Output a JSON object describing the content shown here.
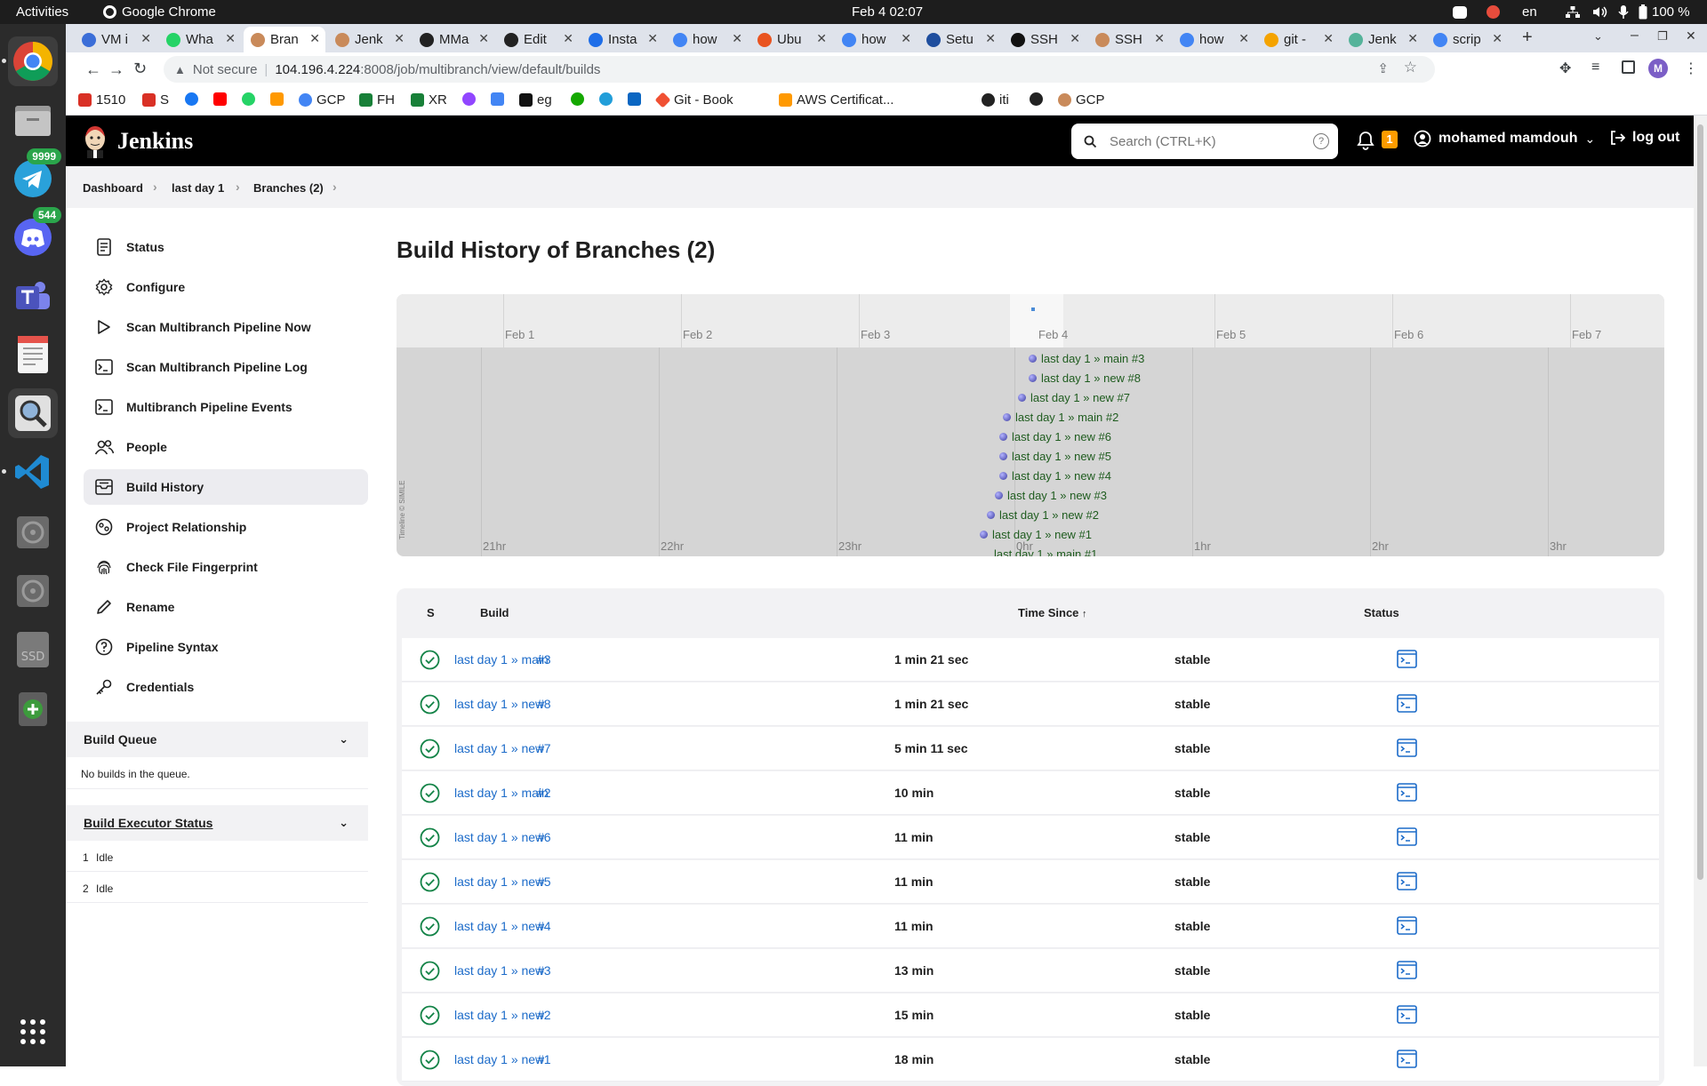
{
  "system_bar": {
    "activities": "Activities",
    "app": "Google Chrome",
    "clock": "Feb 4  02:07",
    "lang": "en",
    "battery": "100 %"
  },
  "dock": {
    "badges": [
      "9999",
      "544"
    ]
  },
  "browser": {
    "tabs": [
      {
        "label": "VM i",
        "color": "#3b6ed8"
      },
      {
        "label": "Wha",
        "color": "#25d366"
      },
      {
        "label": "Bran",
        "color": "#c98a5a"
      },
      {
        "label": "Jenk",
        "color": "#c98a5a"
      },
      {
        "label": "MMa",
        "color": "#222222"
      },
      {
        "label": "Edit",
        "color": "#222222"
      },
      {
        "label": "Insta",
        "color": "#1e6ee8"
      },
      {
        "label": "how",
        "color": "#4285f4"
      },
      {
        "label": "Ubu",
        "color": "#e95420"
      },
      {
        "label": "how",
        "color": "#4285f4"
      },
      {
        "label": "Setu",
        "color": "#1f4e9e"
      },
      {
        "label": "SSH",
        "color": "#111111"
      },
      {
        "label": "SSH",
        "color": "#c98a5a"
      },
      {
        "label": "how",
        "color": "#4285f4"
      },
      {
        "label": "git -",
        "color": "#f4a300"
      },
      {
        "label": "Jenk",
        "color": "#55b39a"
      },
      {
        "label": "scrip",
        "color": "#4285f4"
      }
    ],
    "security": "Not secure",
    "url_host": "104.196.4.224",
    "url_rest": ":8008/job/multibranch/view/default/builds",
    "profile_initial": "M",
    "bookmarks": [
      {
        "label": "1510",
        "color": "#d93025"
      },
      {
        "label": "S",
        "color": "#d93025"
      },
      {
        "label": "",
        "color": "#1877f2"
      },
      {
        "label": "",
        "color": "#ff0000"
      },
      {
        "label": "",
        "color": "#25d366"
      },
      {
        "label": "",
        "color": "#ff9900"
      },
      {
        "label": "GCP",
        "color": "#4285f4"
      },
      {
        "label": "FH",
        "color": "#188038"
      },
      {
        "label": "XR",
        "color": "#188038"
      },
      {
        "label": "",
        "color": "#9146ff"
      },
      {
        "label": "",
        "color": "#4285f4"
      },
      {
        "label": "eg",
        "color": "#111111"
      },
      {
        "label": "",
        "color": "#14a800"
      },
      {
        "label": "",
        "color": "#229ed9"
      },
      {
        "label": "",
        "color": "#0a66c2"
      },
      {
        "label": "Git - Book",
        "color": "#f05033"
      },
      {
        "label": "AWS Certificat...",
        "color": "#ff9900"
      },
      {
        "label": "iti",
        "color": "#222222"
      },
      {
        "label": "",
        "color": "#222222"
      },
      {
        "label": "GCP",
        "color": "#c98a5a"
      }
    ]
  },
  "jenkins": {
    "brand": "Jenkins",
    "search_placeholder": "Search (CTRL+K)",
    "notifications": "1",
    "user": "mohamed mamdouh",
    "logout": "log out"
  },
  "breadcrumbs": [
    "Dashboard",
    "last day 1",
    "Branches (2)"
  ],
  "sidebar": {
    "items": [
      {
        "label": "Status",
        "icon": "document-icon"
      },
      {
        "label": "Configure",
        "icon": "gear-icon"
      },
      {
        "label": "Scan Multibranch Pipeline Now",
        "icon": "play-icon"
      },
      {
        "label": "Scan Multibranch Pipeline Log",
        "icon": "terminal-icon"
      },
      {
        "label": "Multibranch Pipeline Events",
        "icon": "terminal-icon"
      },
      {
        "label": "People",
        "icon": "people-icon"
      },
      {
        "label": "Build History",
        "icon": "inbox-icon",
        "selected": true
      },
      {
        "label": "Project Relationship",
        "icon": "relationship-icon"
      },
      {
        "label": "Check File Fingerprint",
        "icon": "fingerprint-icon"
      },
      {
        "label": "Rename",
        "icon": "pencil-icon"
      },
      {
        "label": "Pipeline Syntax",
        "icon": "help-icon"
      },
      {
        "label": "Credentials",
        "icon": "key-icon"
      }
    ],
    "build_queue": {
      "title": "Build Queue",
      "empty": "No builds in the queue."
    },
    "executors": {
      "title": "Build Executor Status",
      "rows": [
        {
          "num": "1",
          "state": "Idle"
        },
        {
          "num": "2",
          "state": "Idle"
        }
      ]
    }
  },
  "main": {
    "title": "Build History of Branches (2)",
    "timeline": {
      "days": [
        "Feb 1",
        "Feb 2",
        "Feb 3",
        "Feb 4",
        "Feb 5",
        "Feb 6",
        "Feb 7"
      ],
      "hours": [
        "21hr",
        "22hr",
        "23hr",
        "0hr",
        "1hr",
        "2hr",
        "3hr"
      ],
      "credit": "Timeline © SIMILE",
      "events": [
        "last day 1 » main #3",
        "last day 1 » new #8",
        "last day 1 » new #7",
        "last day 1 » main #2",
        "last day 1 » new #6",
        "last day 1 » new #5",
        "last day 1 » new #4",
        "last day 1 » new #3",
        "last day 1 » new #2",
        "last day 1 » new #1",
        "last day 1 » main #1"
      ]
    },
    "table": {
      "headers": {
        "s": "S",
        "build": "Build",
        "time": "Time Since",
        "sort": "↑",
        "status": "Status"
      },
      "rows": [
        {
          "branch": "last day 1 » main",
          "num": "#3",
          "time": "1 min 21 sec",
          "status": "stable"
        },
        {
          "branch": "last day 1 » new",
          "num": "#8",
          "time": "1 min 21 sec",
          "status": "stable"
        },
        {
          "branch": "last day 1 » new",
          "num": "#7",
          "time": "5 min 11 sec",
          "status": "stable"
        },
        {
          "branch": "last day 1 » main",
          "num": "#2",
          "time": "10 min",
          "status": "stable"
        },
        {
          "branch": "last day 1 » new",
          "num": "#6",
          "time": "11 min",
          "status": "stable"
        },
        {
          "branch": "last day 1 » new",
          "num": "#5",
          "time": "11 min",
          "status": "stable"
        },
        {
          "branch": "last day 1 » new",
          "num": "#4",
          "time": "11 min",
          "status": "stable"
        },
        {
          "branch": "last day 1 » new",
          "num": "#3",
          "time": "13 min",
          "status": "stable"
        },
        {
          "branch": "last day 1 » new",
          "num": "#2",
          "time": "15 min",
          "status": "stable"
        },
        {
          "branch": "last day 1 » new",
          "num": "#1",
          "time": "18 min",
          "status": "stable"
        }
      ]
    }
  }
}
